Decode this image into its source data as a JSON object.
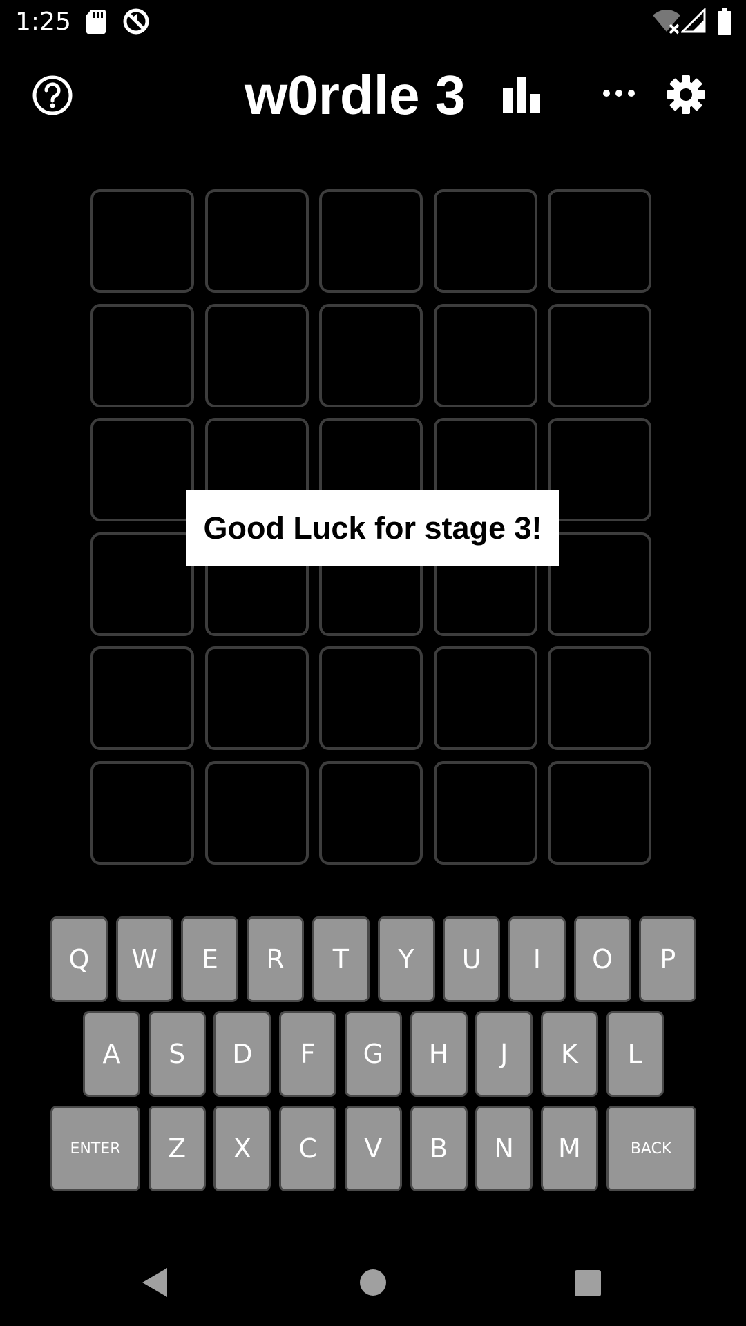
{
  "status_bar": {
    "time": "1:25",
    "icons": [
      "sd-card-icon",
      "no-sync-icon",
      "wifi-off-icon",
      "signal-icon",
      "battery-icon"
    ]
  },
  "header": {
    "title": "w0rdle 3",
    "help_icon": "help-circle-icon",
    "stats_icon": "bar-chart-icon",
    "more_icon": "more-horizontal-icon",
    "settings_icon": "gear-icon"
  },
  "board": {
    "rows": [
      [
        "",
        "",
        "",
        "",
        ""
      ],
      [
        "",
        "",
        "",
        "",
        ""
      ],
      [
        "",
        "",
        "",
        "",
        ""
      ],
      [
        "",
        "",
        "",
        "",
        ""
      ],
      [
        "",
        "",
        "",
        "",
        ""
      ],
      [
        "",
        "",
        "",
        "",
        ""
      ]
    ]
  },
  "toast": {
    "message": "Good Luck for stage 3!"
  },
  "keyboard": {
    "row1": [
      "Q",
      "W",
      "E",
      "R",
      "T",
      "Y",
      "U",
      "I",
      "O",
      "P"
    ],
    "row2": [
      "A",
      "S",
      "D",
      "F",
      "G",
      "H",
      "J",
      "K",
      "L"
    ],
    "row3": [
      "ENTER",
      "Z",
      "X",
      "C",
      "V",
      "B",
      "N",
      "M",
      "BACK"
    ]
  },
  "nav_bar": {
    "icons": [
      "back-triangle-icon",
      "home-circle-icon",
      "recents-square-icon"
    ]
  },
  "colors": {
    "background": "#000000",
    "tile_border": "#3d3d3d",
    "key_fill": "#969696",
    "key_border": "#4a4a4a",
    "toast_bg": "#ffffff"
  }
}
